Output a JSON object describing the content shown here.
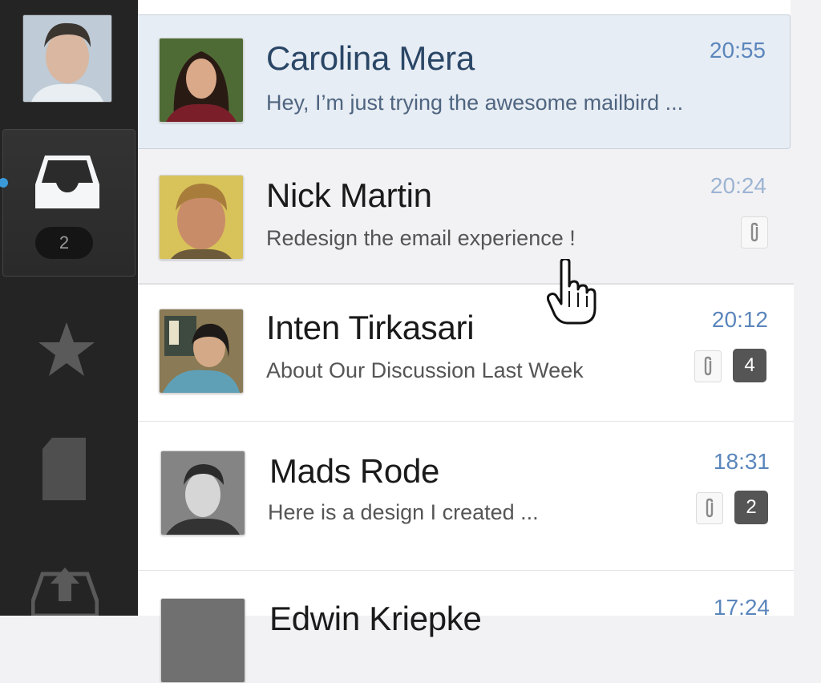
{
  "sidebar": {
    "inbox_badge": "2",
    "items": [
      {
        "name": "inbox"
      },
      {
        "name": "starred"
      },
      {
        "name": "drafts"
      },
      {
        "name": "sent"
      }
    ]
  },
  "emails": [
    {
      "sender": "Carolina Mera",
      "preview": "Hey, I’m just trying the awesome mailbird ...",
      "time": "20:55"
    },
    {
      "sender": "Nick Martin",
      "preview": "Redesign the email experience !",
      "time": "20:24"
    },
    {
      "sender": "Inten Tirkasari",
      "preview": "About Our Discussion Last Week",
      "time": "20:12",
      "count": "4"
    },
    {
      "sender": "Mads Rode",
      "preview": "Here is a design I created ...",
      "time": "18:31",
      "count": "2"
    },
    {
      "sender": "Edwin Kriepke",
      "time": "17:24"
    }
  ],
  "colors": {
    "sidebar": "#242424",
    "accent": "#3a9ad9",
    "time": "#5b86bc",
    "selected_row": "#e7edf4"
  }
}
